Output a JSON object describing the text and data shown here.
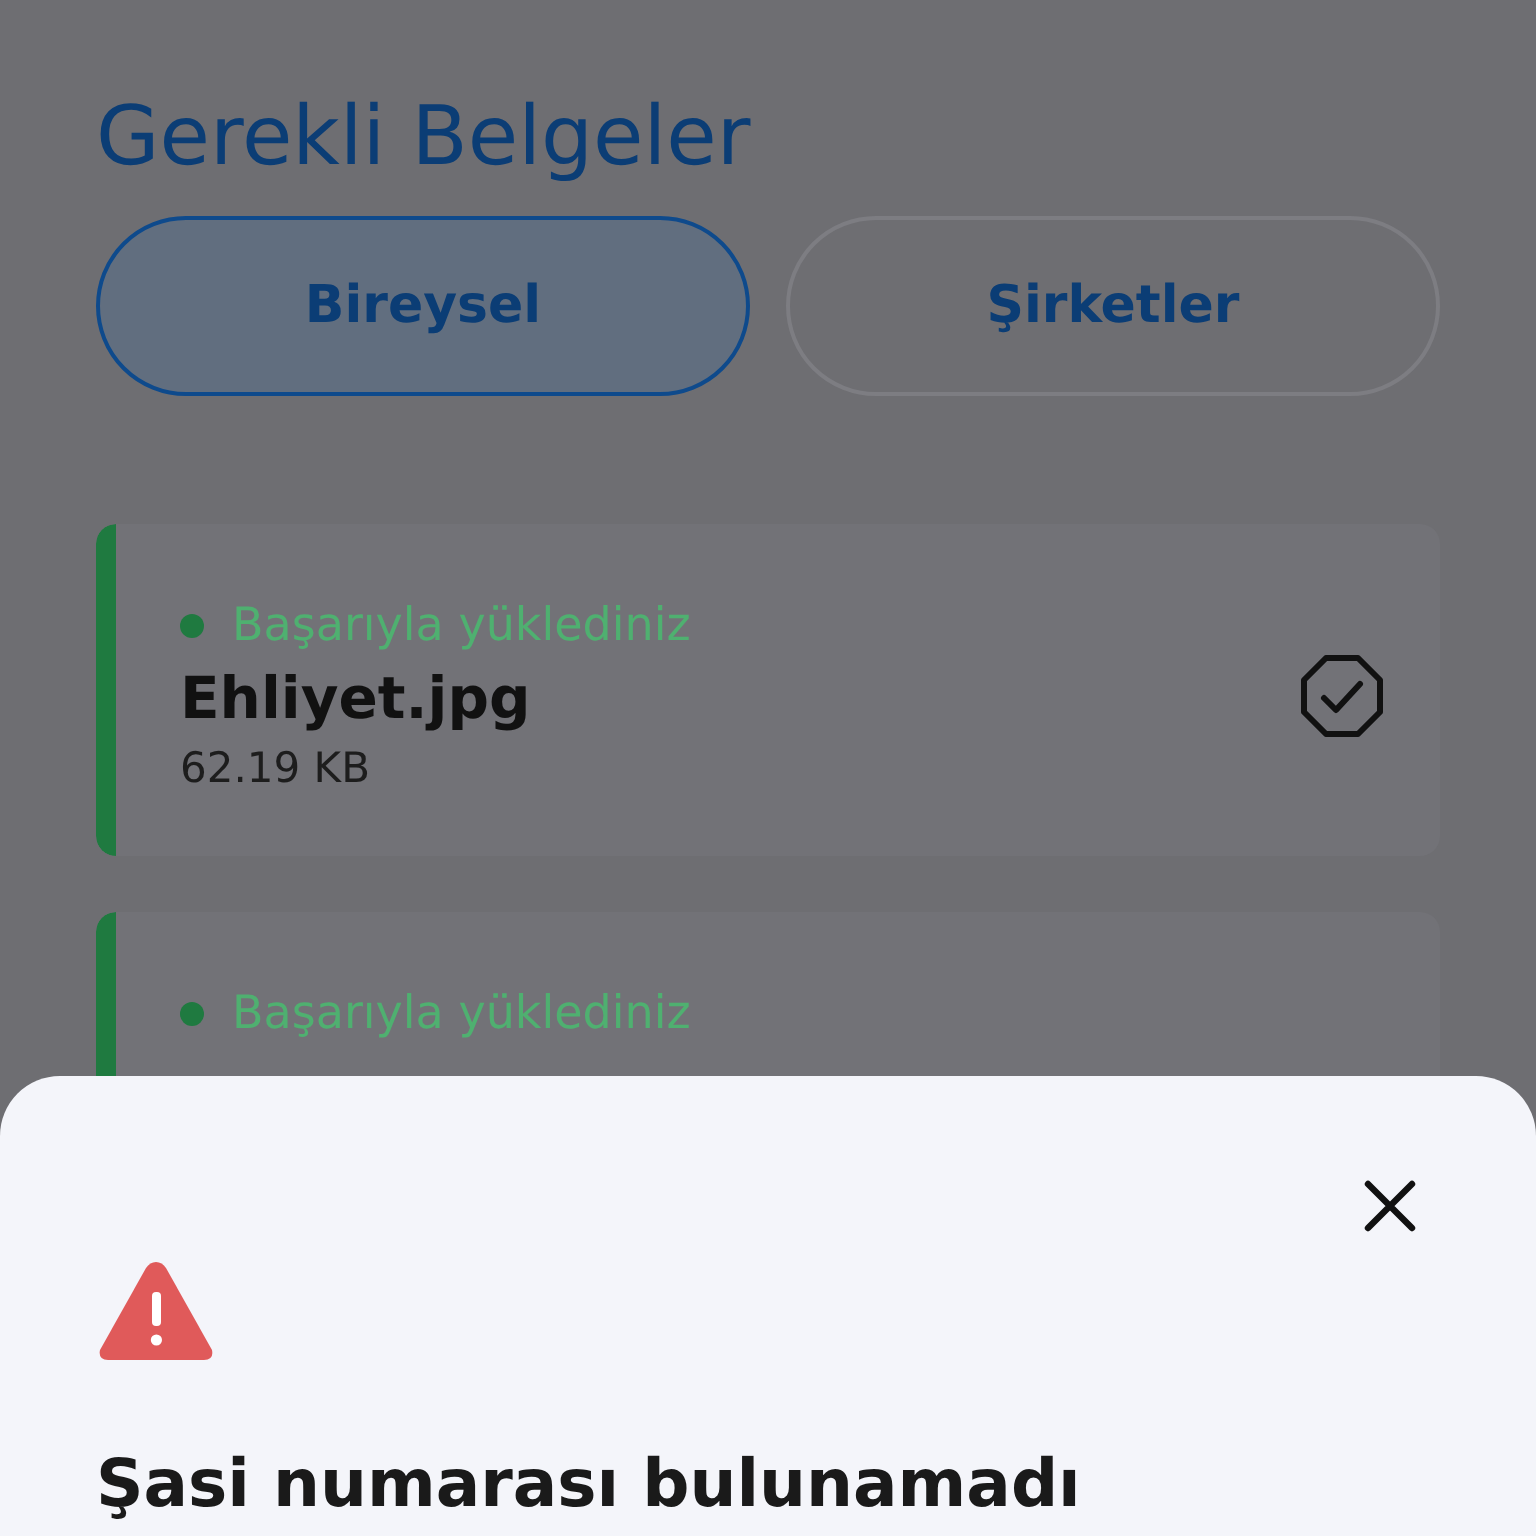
{
  "page": {
    "title": "Gerekli Belgeler"
  },
  "tabs": [
    {
      "label": "Bireysel",
      "selected": true
    },
    {
      "label": "Şirketler",
      "selected": false
    }
  ],
  "documents": [
    {
      "status": "Başarıyla yüklediniz",
      "file_name": "Ehliyet.jpg",
      "size": "62.19 KB",
      "checked": true
    },
    {
      "status": "Başarıyla yüklediniz"
    }
  ],
  "sheet": {
    "title": "Şasi numarası bulunamadı"
  }
}
